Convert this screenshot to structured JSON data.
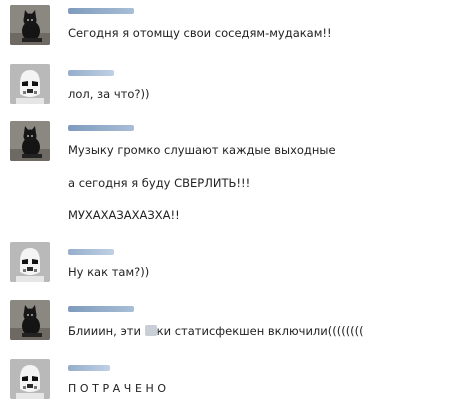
{
  "colors": {
    "name_bar_top": "#6d8fb5",
    "name_bar_bottom": "#a3bbd6",
    "message_text": "#222222",
    "background": "#ffffff"
  },
  "avatars": {
    "user_a": "black-cat-avatar",
    "user_b": "stormtrooper-avatar"
  },
  "messages": [
    {
      "sender": "user_a",
      "lines": [
        "Сегодня я отомщу свои соседям-мудакам!!"
      ]
    },
    {
      "sender": "user_b",
      "lines": [
        "лол, за что?))"
      ]
    },
    {
      "sender": "user_a",
      "lines": [
        "Музыку громко слушают каждые выходные",
        "а сегодня я буду СВЕРЛИТЬ!!!",
        "МУХАХАЗАХАЗХА!!"
      ]
    },
    {
      "sender": "user_b",
      "lines": [
        "Ну как там?))"
      ]
    },
    {
      "sender": "user_a",
      "lines_parts": {
        "before": "Блииин, эти ",
        "censored": "censored-word",
        "after": "ки статисфекшен включили(((((((("
      }
    },
    {
      "sender": "user_b",
      "lines": [
        "ПОТРАЧЕНО"
      ]
    }
  ]
}
